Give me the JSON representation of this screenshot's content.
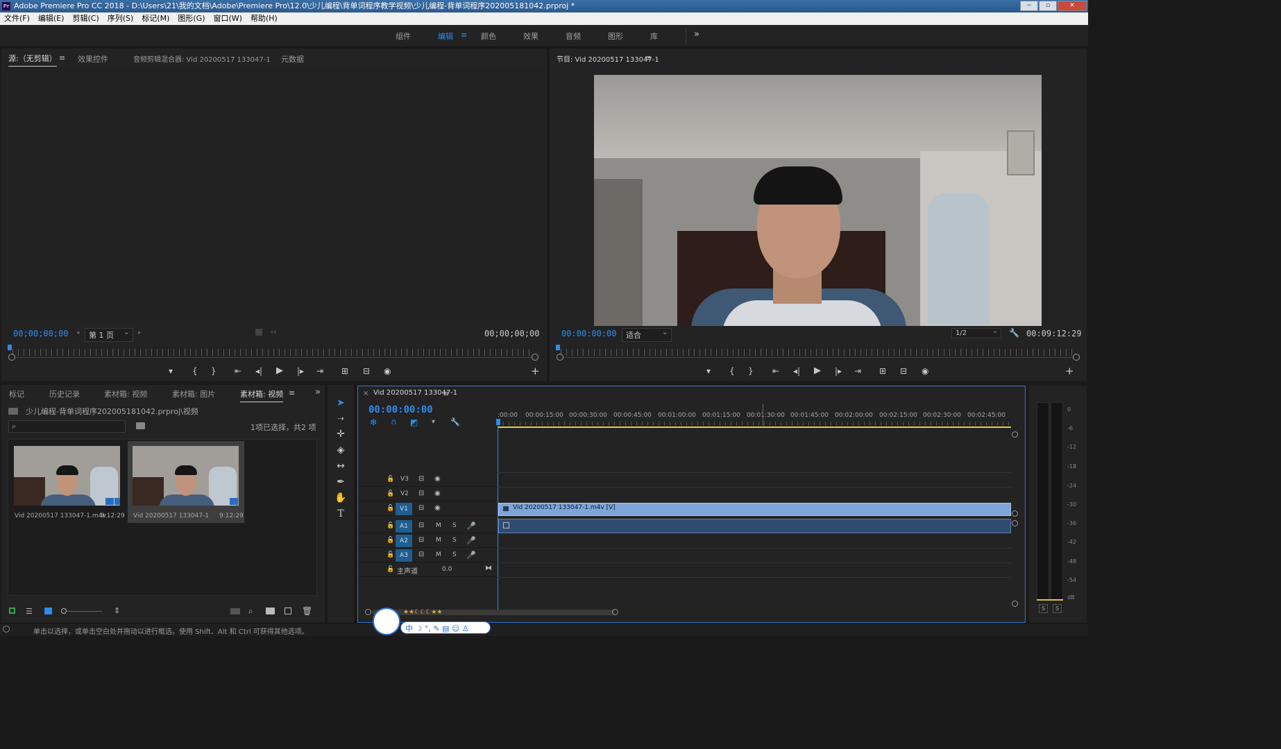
{
  "window": {
    "app_icon": "Pr",
    "title": "Adobe Premiere Pro CC 2018 - D:\\Users\\21\\我的文档\\Adobe\\Premiere Pro\\12.0\\少儿编程\\背单词程序教学视频\\少儿编程-背单词程序202005181042.prproj *",
    "min": "−",
    "max": "▫",
    "close": "✕"
  },
  "menu": [
    "文件(F)",
    "编辑(E)",
    "剪辑(C)",
    "序列(S)",
    "标记(M)",
    "图形(G)",
    "窗口(W)",
    "帮助(H)"
  ],
  "workspaces": [
    "组件",
    "编辑",
    "颜色",
    "效果",
    "音频",
    "图形",
    "库"
  ],
  "active_workspace": "编辑",
  "workspace_more": "»",
  "source": {
    "tabs": [
      "源:（无剪辑）",
      "效果控件",
      "音频剪辑混合器: Vid 20200517 133047-1",
      "元数据"
    ],
    "timecode_in": "00;00;00;00",
    "page": "第 1 页",
    "timecode_out": "00;00;00;00"
  },
  "program": {
    "tab": "节目: Vid 20200517 133047-1",
    "timecode_in": "00:00:00:00",
    "fit": "适合",
    "resolution": "1/2",
    "timecode_out": "00:09:12:29"
  },
  "transport_glyphs": [
    "▾",
    "{",
    "}",
    "⇤",
    "◂|",
    "▶",
    "|▸",
    "⇥",
    "⊞",
    "⊟",
    "◉"
  ],
  "add": "+",
  "project": {
    "tabs": [
      "标记",
      "历史记录",
      "素材箱: 视频",
      "素材箱: 图片",
      "素材箱: 视频"
    ],
    "more": "»",
    "path": "少儿编程-背单词程序202005181042.prproj\\视频",
    "selection": "1项已选择，共2 项",
    "items": [
      {
        "name": "Vid 20200517 133047-1.m4v",
        "duration": "9:12:29"
      },
      {
        "name": "Vid 20200517 133047-1",
        "duration": "9:12:29"
      }
    ]
  },
  "timeline": {
    "close": "×",
    "tab": "Vid 20200517 133047-1",
    "timecode": "00:00:00:00",
    "ruler": [
      ":00:00",
      "00:00:15:00",
      "00:00:30:00",
      "00:00:45:00",
      "00:01:00:00",
      "00:01:15:00",
      "00:01:30:00",
      "00:01:45:00",
      "00:02:00:00",
      "00:02:15:00",
      "00:02:30:00",
      "00:02:45:00"
    ],
    "video_tracks": [
      "V3",
      "V2",
      "V1"
    ],
    "audio_tracks": [
      "A1",
      "A2",
      "A3"
    ],
    "master": "主声道",
    "master_value": "0.0",
    "clip_label": "Vid 20200517 133047-1.m4v [V]",
    "mute": "M",
    "solo": "S"
  },
  "meter": {
    "ticks": [
      "0",
      "-6",
      "-12",
      "-18",
      "-24",
      "-30",
      "-36",
      "-42",
      "-48",
      "-54",
      "dB"
    ],
    "solo_buttons": [
      "S",
      "S"
    ]
  },
  "status": "单击以选择，或单击空白处并拖动以进行框选。使用 Shift、Alt 和 Ctrl 可获得其他选项。",
  "ime": {
    "stars": "★★☾☾☾★★",
    "chars": "中 ☽ °, ✎ ▤ ☺ ♙"
  }
}
